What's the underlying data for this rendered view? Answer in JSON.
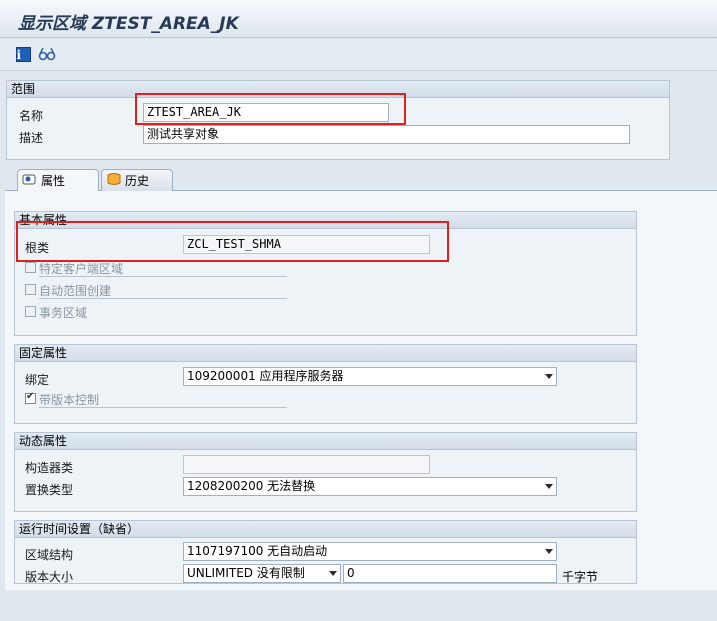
{
  "window": {
    "title": "显示区域 ZTEST_AREA_JK"
  },
  "toolbar": {
    "info_icon": "info-icon",
    "glasses_icon": "glasses-icon"
  },
  "scope": {
    "title": "范围",
    "name_label": "名称",
    "name_value": "ZTEST_AREA_JK",
    "desc_label": "描述",
    "desc_value": "测试共享对象"
  },
  "tabs": [
    {
      "label": "属性",
      "active": true
    },
    {
      "label": "历史",
      "active": false
    }
  ],
  "basic": {
    "title": "基本属性",
    "root_class_label": "根类",
    "root_class_value": "ZCL_TEST_SHMA",
    "client_specific": "特定客户端区域",
    "auto_create": "自动范围创建",
    "transactional": "事务区域"
  },
  "fixed": {
    "title": "固定属性",
    "binding_label": "绑定",
    "binding_value": "109200001 应用程序服务器",
    "versioning_label": "带版本控制",
    "versioning_checked": true
  },
  "dynamic": {
    "title": "动态属性",
    "constructor_label": "构造器类",
    "constructor_value": "",
    "displacement_label": "置换类型",
    "displacement_value": "1208200200 无法替换"
  },
  "runtime": {
    "title": "运行时间设置（缺省）",
    "structure_label": "区域结构",
    "structure_value": "1107197100 无自动启动",
    "size_label": "版本大小",
    "size_value": "UNLIMITED 没有限制",
    "size_number": "0",
    "size_unit": "千字节"
  },
  "colors": {
    "highlight": "#e0201c",
    "panel": "#eef3f8"
  }
}
